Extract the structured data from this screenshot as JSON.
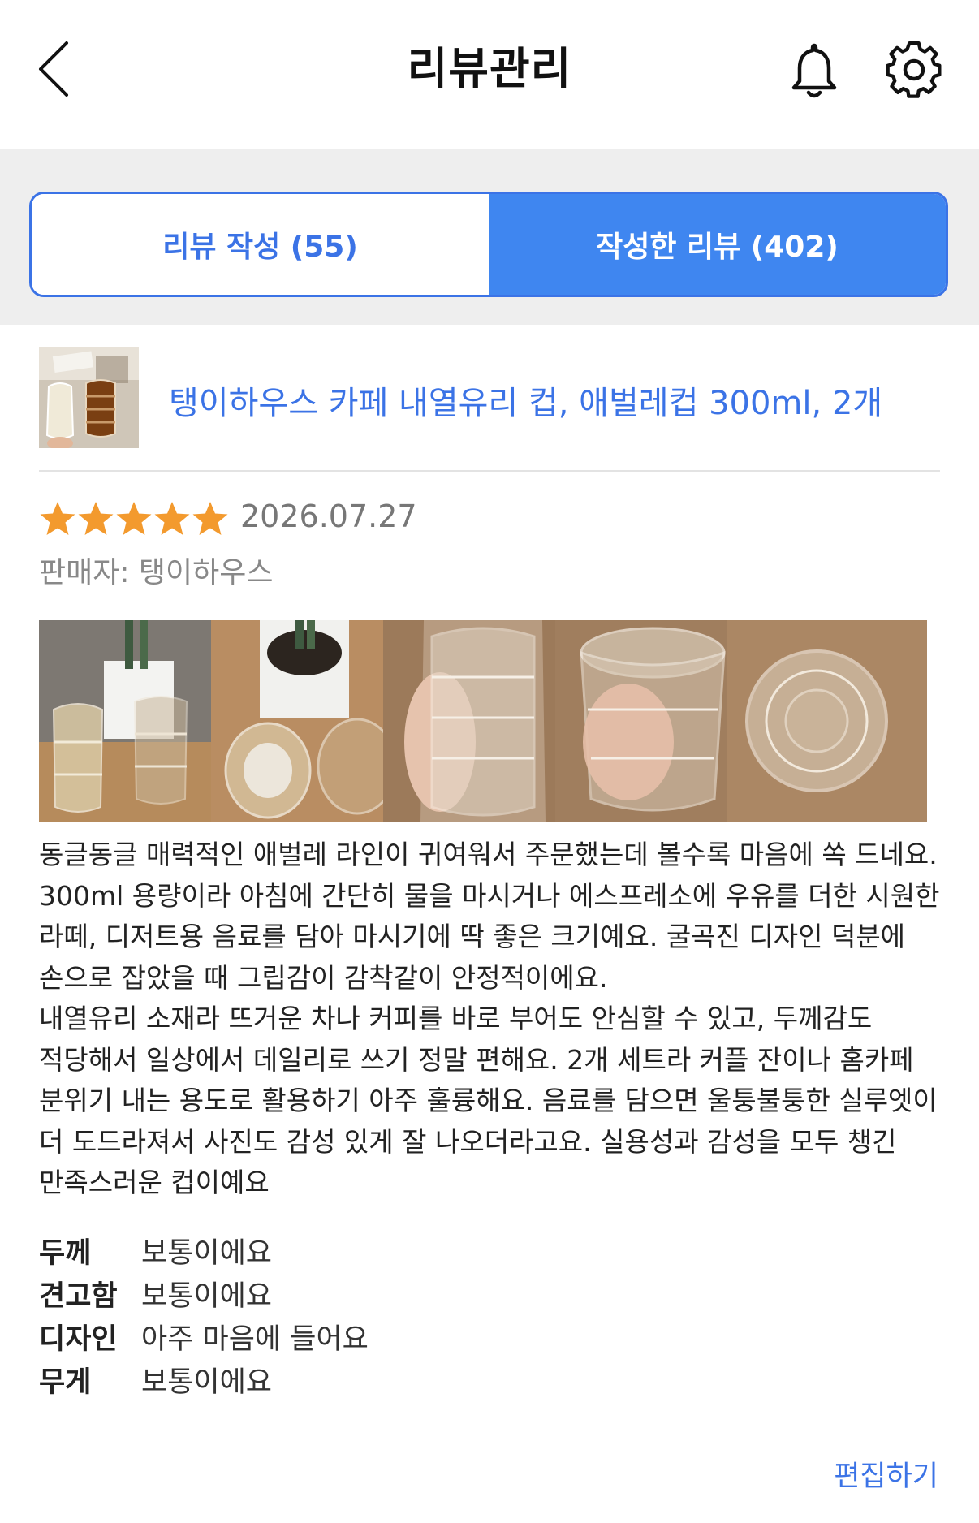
{
  "header": {
    "title": "리뷰관리",
    "back_icon": "chevron-left-icon",
    "bell_icon": "bell-icon",
    "settings_icon": "gear-icon"
  },
  "tabs": [
    {
      "label": "리뷰 작성 (55)",
      "active": false
    },
    {
      "label": "작성한 리뷰 (402)",
      "active": true
    }
  ],
  "product": {
    "name": "탱이하우스 카페 내열유리 컵, 애벌레컵 300ml, 2개"
  },
  "review": {
    "rating": 5,
    "rating_max": 5,
    "date": "2026.07.27",
    "seller": "판매자: 탱이하우스",
    "photo_count_visible": 5,
    "text": "동글동글 매력적인 애벌레 라인이 귀여워서 주문했는데 볼수록 마음에 쏙 드네요. 300ml 용량이라 아침에 간단히 물을 마시거나 에스프레소에 우유를 더한 시원한 라떼, 디저트용 음료를 담아 마시기에 딱 좋은 크기예요. 굴곡진 디자인 덕분에 손으로 잡았을 때 그립감이 감착같이 안정적이에요.\n내열유리 소재라 뜨거운 차나 커피를 바로 부어도 안심할 수 있고, 두께감도 적당해서 일상에서 데일리로 쓰기 정말 편해요. 2개 세트라 커플 잔이나 홈카페 분위기 내는 용도로 활용하기 아주 훌륭해요. 음료를 담으면 울퉁불퉁한 실루엣이 더 도드라져서 사진도 감성 있게 잘 나오더라고요. 실용성과 감성을 모두 챙긴 만족스러운 컵이예요",
    "attributes": [
      {
        "key": "두께",
        "value": "보통이에요"
      },
      {
        "key": "견고함",
        "value": "보통이에요"
      },
      {
        "key": "디자인",
        "value": "아주 마음에 들어요"
      },
      {
        "key": "무게",
        "value": "보통이에요"
      }
    ],
    "edit_label": "편집하기"
  },
  "colors": {
    "accent": "#3b73e6",
    "tab_active_bg": "#3f86f0",
    "star": "#f39a2e",
    "band_bg": "#eeeeee"
  }
}
